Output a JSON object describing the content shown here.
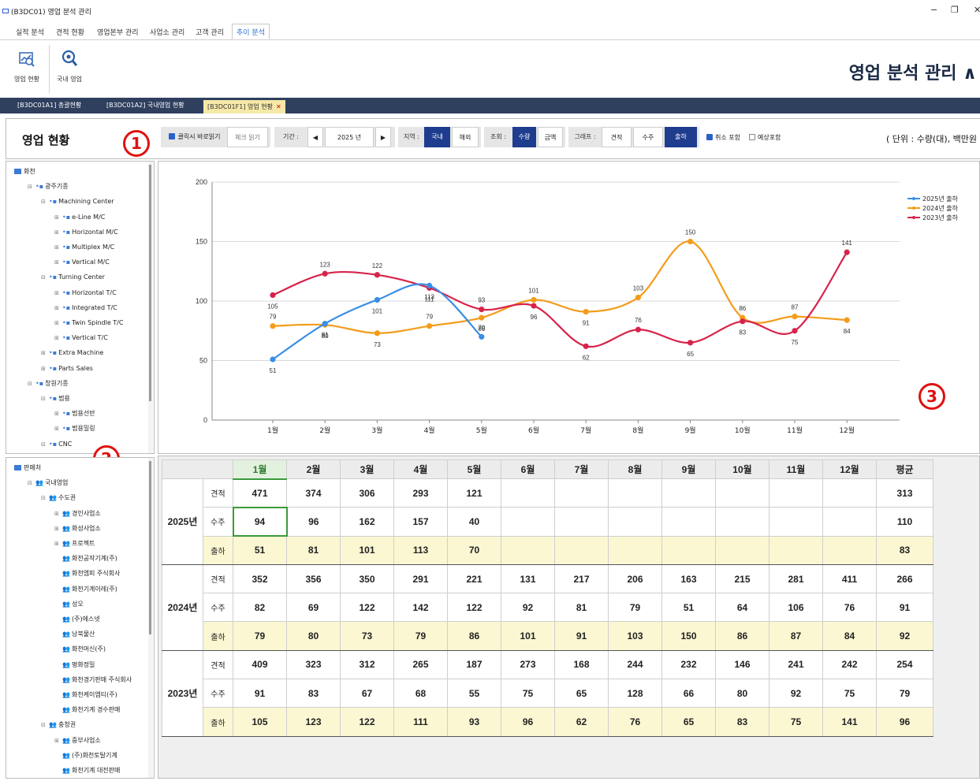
{
  "window": {
    "title": "(B3DC01) 영업 분석 관리",
    "minimize": "−",
    "restore": "❐",
    "close": "✕"
  },
  "menu": {
    "items": [
      "실적 분석",
      "견적 현황",
      "영업본부 관리",
      "사업소 관리",
      "고객 관리",
      "추이 분석"
    ],
    "active_index": 5
  },
  "ribbon": {
    "buttons": [
      {
        "label": "영업 현황",
        "icon": "sales-status-icon"
      },
      {
        "label": "국내 영업",
        "icon": "magnifier-icon"
      }
    ],
    "app_title": "영업 분석 관리",
    "collapse_glyph": "∧"
  },
  "tabs": {
    "items": [
      "[B3DC01A1] 총괄현황",
      "[B3DC01A2] 국내영업 현황",
      "[B3DC01F1] 영업 현황"
    ],
    "active_index": 2,
    "close": "✕"
  },
  "toolbar": {
    "page_title": "영업 현황",
    "click_read_label": "클릭시 바로읽기",
    "check_read_label": "체크 읽기",
    "period_label": "기간 :",
    "prev": "◀",
    "year_value": "2025 년",
    "next": "▶",
    "region_label": "지역 :",
    "region_options": [
      "국내",
      "해외"
    ],
    "region_selected": "국내",
    "query_label": "조회 :",
    "query_options": [
      "수량",
      "금액"
    ],
    "query_selected": "수량",
    "graph_label": "그래프 :",
    "graph_options": [
      "견적",
      "수주",
      "출하"
    ],
    "graph_selected": "출하",
    "cancel_include": "취소 포함",
    "forecast_include": "예상포함",
    "unit": "( 단위 : 수량(대), 백만원"
  },
  "callouts": [
    "1",
    "2",
    "3"
  ],
  "tree_product": [
    {
      "label": "화천",
      "level": 0,
      "icon": "root"
    },
    {
      "label": "광주기종",
      "level": 1,
      "icon": "group",
      "ex": "⊟"
    },
    {
      "label": "Machining Center",
      "level": 2,
      "icon": "group",
      "ex": "⊟"
    },
    {
      "label": "e-Line M/C",
      "level": 3,
      "icon": "group",
      "ex": "⊞"
    },
    {
      "label": "Horizontal M/C",
      "level": 3,
      "icon": "group",
      "ex": "⊞"
    },
    {
      "label": "Multiplex M/C",
      "level": 3,
      "icon": "group",
      "ex": "⊞"
    },
    {
      "label": "Vertical M/C",
      "level": 3,
      "icon": "group",
      "ex": "⊞"
    },
    {
      "label": "Turning Center",
      "level": 2,
      "icon": "group",
      "ex": "⊟"
    },
    {
      "label": "Horizontal T/C",
      "level": 3,
      "icon": "group",
      "ex": "⊞"
    },
    {
      "label": "Integrated T/C",
      "level": 3,
      "icon": "group",
      "ex": "⊞"
    },
    {
      "label": "Twin Spindle T/C",
      "level": 3,
      "icon": "group",
      "ex": "⊞"
    },
    {
      "label": "Vertical T/C",
      "level": 3,
      "icon": "group",
      "ex": "⊞"
    },
    {
      "label": "Extra Machine",
      "level": 2,
      "icon": "group",
      "ex": "⊞"
    },
    {
      "label": "Parts Sales",
      "level": 2,
      "icon": "group",
      "ex": "⊞"
    },
    {
      "label": "창원기종",
      "level": 1,
      "icon": "group",
      "ex": "⊟"
    },
    {
      "label": "범용",
      "level": 2,
      "icon": "group",
      "ex": "⊟"
    },
    {
      "label": "범용선반",
      "level": 3,
      "icon": "group",
      "ex": "⊞"
    },
    {
      "label": "범용밀링",
      "level": 3,
      "icon": "group",
      "ex": "⊞"
    },
    {
      "label": "CNC",
      "level": 2,
      "icon": "group",
      "ex": "⊟"
    }
  ],
  "tree_customer": [
    {
      "label": "판매처",
      "level": 0,
      "icon": "root"
    },
    {
      "label": "국내영업",
      "level": 1,
      "icon": "people",
      "ex": "⊟"
    },
    {
      "label": "수도권",
      "level": 2,
      "icon": "people",
      "ex": "⊟"
    },
    {
      "label": "경인사업소",
      "level": 3,
      "icon": "people",
      "ex": "⊞"
    },
    {
      "label": "화성사업소",
      "level": 3,
      "icon": "people",
      "ex": "⊞"
    },
    {
      "label": "프로젝트",
      "level": 3,
      "icon": "people",
      "ex": "⊞"
    },
    {
      "label": "화천공작기계(주)",
      "level": 3,
      "icon": "people",
      "ex": ""
    },
    {
      "label": "화천엠피 주식회사",
      "level": 3,
      "icon": "people",
      "ex": ""
    },
    {
      "label": "화천기계이레(주)",
      "level": 3,
      "icon": "people",
      "ex": ""
    },
    {
      "label": "성오",
      "level": 3,
      "icon": "people",
      "ex": ""
    },
    {
      "label": "(주)에스넷",
      "level": 3,
      "icon": "people",
      "ex": ""
    },
    {
      "label": "남북물산",
      "level": 3,
      "icon": "people",
      "ex": ""
    },
    {
      "label": "화천머신(주)",
      "level": 3,
      "icon": "people",
      "ex": ""
    },
    {
      "label": "평화정밀",
      "level": 3,
      "icon": "people",
      "ex": ""
    },
    {
      "label": "화천경기판매 주식회사",
      "level": 3,
      "icon": "people",
      "ex": ""
    },
    {
      "label": "화천케이엠티(주)",
      "level": 3,
      "icon": "people",
      "ex": ""
    },
    {
      "label": "화천기계 경수판매",
      "level": 3,
      "icon": "people",
      "ex": ""
    },
    {
      "label": "충청권",
      "level": 2,
      "icon": "people",
      "ex": "⊟"
    },
    {
      "label": "중부사업소",
      "level": 3,
      "icon": "people",
      "ex": "⊞"
    },
    {
      "label": "(주)화천토탈기계",
      "level": 3,
      "icon": "people",
      "ex": ""
    },
    {
      "label": "화천기계 대전판매",
      "level": 3,
      "icon": "people",
      "ex": ""
    }
  ],
  "chart_data": {
    "type": "line",
    "categories": [
      "1월",
      "2월",
      "3월",
      "4월",
      "5월",
      "6월",
      "7월",
      "8월",
      "9월",
      "10월",
      "11월",
      "12월"
    ],
    "ylim": [
      0,
      200
    ],
    "yticks": [
      0,
      50,
      100,
      150,
      200
    ],
    "grid": true,
    "legend_position": "top-right",
    "series": [
      {
        "name": "2025년 출하",
        "color": "#3a8ee6",
        "values": [
          51,
          81,
          101,
          113,
          70
        ]
      },
      {
        "name": "2024년 출하",
        "color": "#f39c1a",
        "values": [
          79,
          80,
          73,
          79,
          86,
          101,
          91,
          103,
          150,
          86,
          87,
          84
        ]
      },
      {
        "name": "2023년 출하",
        "color": "#d7234a",
        "values": [
          105,
          123,
          122,
          111,
          93,
          96,
          62,
          76,
          65,
          83,
          75,
          141
        ]
      }
    ]
  },
  "grid": {
    "months": [
      "1월",
      "2월",
      "3월",
      "4월",
      "5월",
      "6월",
      "7월",
      "8월",
      "9월",
      "10월",
      "11월",
      "12월"
    ],
    "avg_label": "평균",
    "years": [
      {
        "year": "2025년",
        "rows": [
          {
            "kind": "견적",
            "values": [
              "471",
              "374",
              "306",
              "293",
              "121",
              "",
              "",
              "",
              "",
              "",
              "",
              ""
            ],
            "avg": "313"
          },
          {
            "kind": "수주",
            "values": [
              "94",
              "96",
              "162",
              "157",
              "40",
              "",
              "",
              "",
              "",
              "",
              "",
              ""
            ],
            "avg": "110"
          },
          {
            "kind": "출하",
            "values": [
              "51",
              "81",
              "101",
              "113",
              "70",
              "",
              "",
              "",
              "",
              "",
              "",
              ""
            ],
            "avg": "83"
          }
        ]
      },
      {
        "year": "2024년",
        "rows": [
          {
            "kind": "견적",
            "values": [
              "352",
              "356",
              "350",
              "291",
              "221",
              "131",
              "217",
              "206",
              "163",
              "215",
              "281",
              "411"
            ],
            "avg": "266"
          },
          {
            "kind": "수주",
            "values": [
              "82",
              "69",
              "122",
              "142",
              "122",
              "92",
              "81",
              "79",
              "51",
              "64",
              "106",
              "76"
            ],
            "avg": "91"
          },
          {
            "kind": "출하",
            "values": [
              "79",
              "80",
              "73",
              "79",
              "86",
              "101",
              "91",
              "103",
              "150",
              "86",
              "87",
              "84"
            ],
            "avg": "92"
          }
        ]
      },
      {
        "year": "2023년",
        "rows": [
          {
            "kind": "견적",
            "values": [
              "409",
              "323",
              "312",
              "265",
              "187",
              "273",
              "168",
              "244",
              "232",
              "146",
              "241",
              "242"
            ],
            "avg": "254"
          },
          {
            "kind": "수주",
            "values": [
              "91",
              "83",
              "67",
              "68",
              "55",
              "75",
              "65",
              "128",
              "66",
              "80",
              "92",
              "75"
            ],
            "avg": "79"
          },
          {
            "kind": "출하",
            "values": [
              "105",
              "123",
              "122",
              "111",
              "93",
              "96",
              "62",
              "76",
              "65",
              "83",
              "75",
              "141"
            ],
            "avg": "96"
          }
        ]
      }
    ]
  }
}
